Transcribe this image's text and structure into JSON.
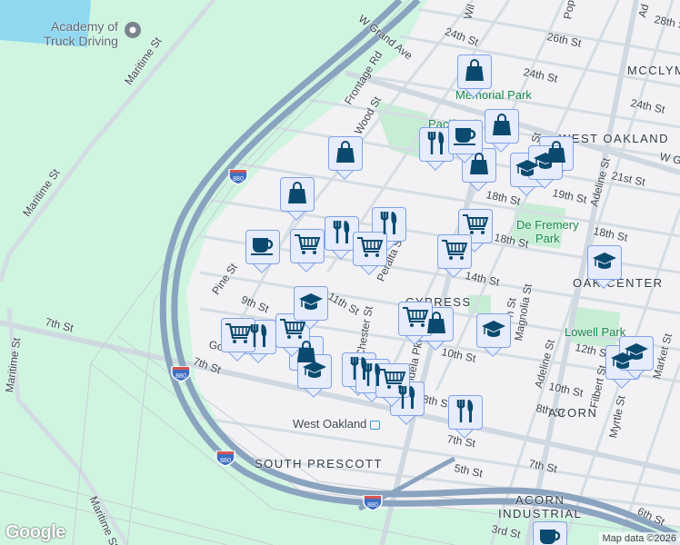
{
  "map": {
    "poi": {
      "name_line1": "Academy of",
      "name_line2": "Truck Driving"
    },
    "streets": {
      "maritime_1": "Maritime St",
      "maritime_2": "Maritime St",
      "maritime_3": "Maritime St",
      "maritime_4": "Maritime St",
      "maritime_top": "Maritime St",
      "w_grand": "W Grand Ave",
      "frontage": "Frontage Rd",
      "wood": "Wood St",
      "s24_a": "24th St",
      "s26": "26th St",
      "s24_b": "24th St",
      "s24_c": "24th St",
      "s28": "28th St",
      "s21": "21st St",
      "s19": "19th St",
      "s18_a": "18th St",
      "s18_b": "18th St",
      "s18_c": "18th St",
      "s14": "14th St",
      "s11": "11th St",
      "s9": "9th St",
      "s10_a": "10th St",
      "s10_b": "10th St",
      "s10_c": "10th St",
      "s12": "12th St",
      "s8_a": "8th St",
      "s8_b": "8th St",
      "s7_a": "7th St",
      "s7_b": "7th St",
      "s7_c": "7th St",
      "s7_d": "7th St",
      "s5": "5th St",
      "s6": "6th St",
      "s3": "3rd St",
      "pine": "Pine St",
      "peralta": "Peralta St",
      "chester": "Chester St",
      "mandela": "Mandela Pkwy",
      "adeline_a": "Adeline St",
      "adeline_b": "Adeline St",
      "magnolia": "Magnolia St",
      "filbert": "Filbert St",
      "myrtle": "Myrtle St",
      "market": "Market St",
      "w_gr_e": "W Gr",
      "gosford": "Gos",
      "poplar": "Pop",
      "willow": "Wil",
      "ad_top": "Ad",
      "linden": "n St",
      "union": "lar St"
    },
    "neighborhoods": {
      "west_oakland": "WEST OAKLAND",
      "mcclymonds": "MCCLYM",
      "cypress_1": "CYPRESS",
      "cypress_2": "E",
      "oak_center": "OAK CENTER",
      "acorn": "ACORN",
      "acorn_ind_1": "ACORN",
      "acorn_ind_2": "INDUSTRIAL",
      "south_prescott": "SOUTH PRESCOTT",
      "prescott": "C"
    },
    "parks": {
      "memorial": "Memorial Park",
      "pacific": "Pacific Pi",
      "de_fremery_1": "De Fremery",
      "de_fremery_2": "Park",
      "lowell": "Lowell Park"
    },
    "transit": {
      "west_oakland": "West Oakland"
    },
    "highway_shield": "880",
    "attribution": "Map data ©2026",
    "google_logo": "Google",
    "colors": {
      "marker_fill": "#e6ecfb",
      "marker_border": "#7fa2ea",
      "icon": "#0b4a6f",
      "green": "#cff5e0",
      "highway": "#8aa3bf",
      "water": "#8fd8f0"
    }
  }
}
